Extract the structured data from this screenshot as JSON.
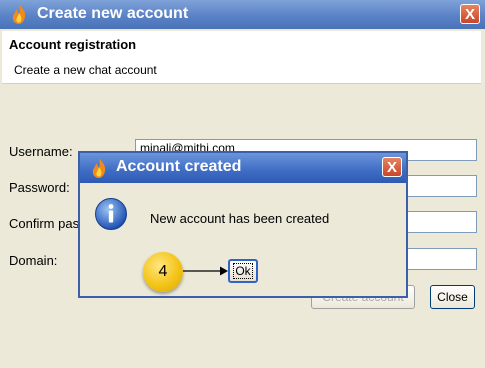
{
  "window": {
    "title": "Create new account",
    "close_label": "X"
  },
  "header": {
    "title": "Account registration",
    "subtitle": "Create a new chat account"
  },
  "form": {
    "username_label": "Username:",
    "username_value": "minali@mithi.com",
    "password_label": "Password:",
    "confirm_label": "Confirm pas",
    "domain_label": "Domain:"
  },
  "buttons": {
    "create_label": "Create account",
    "close_label": "Close"
  },
  "dialog": {
    "title": "Account created",
    "close_label": "X",
    "message": "New account has been created",
    "ok_label": "Ok"
  },
  "annotation": {
    "step": "4"
  },
  "colors": {
    "titlebar": "#5a82c6",
    "dialog_titlebar": "#3e6cc4",
    "close_red": "#c8462a",
    "badge_yellow": "#f3c417"
  },
  "icons": [
    "flame-icon",
    "close-icon",
    "info-icon",
    "arrow-icon"
  ]
}
